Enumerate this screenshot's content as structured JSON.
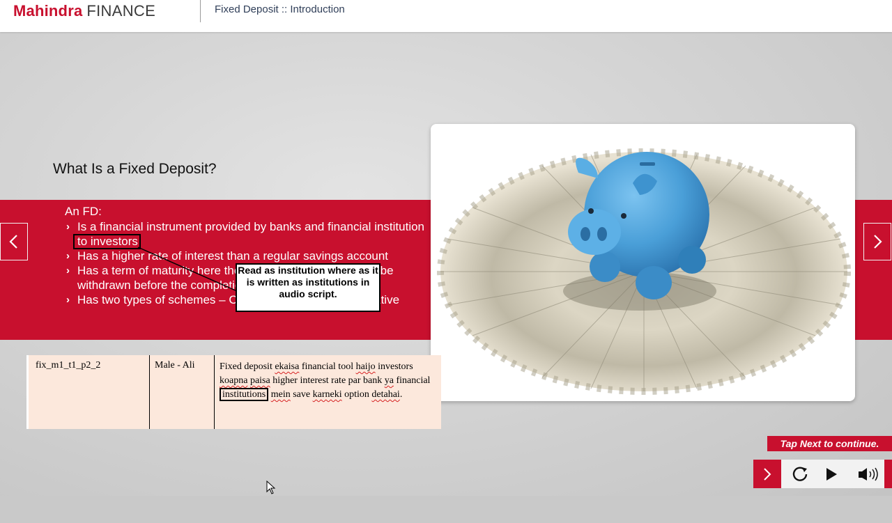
{
  "header": {
    "brand": "Mahindra",
    "brand_sub": "FINANCE",
    "breadcrumb": "Fixed Deposit :: Introduction"
  },
  "slide": {
    "title": "What Is a Fixed Deposit?",
    "intro": "An FD:",
    "bullets": [
      {
        "before": "Is a financial instrument provided by banks and financial ",
        "highlight": "institution",
        "after": " to investors"
      },
      {
        "text": "Has a higher rate of interest than a regular savings account"
      },
      {
        "text": "Has a term of maturity here the deposited amount cannot be withdrawn before the completion"
      },
      {
        "text": "Has two types of schemes – Cumulative and Non-Cumulative"
      }
    ],
    "callout": "Read as institution where as it is written as institutions in audio script."
  },
  "script_table": {
    "id": "fix_m1_t1_p2_2",
    "voice": "Male - Ali",
    "text_parts": {
      "p1": "Fixed deposit ",
      "w1": "ekaisa",
      "p2": " financial tool ",
      "w2": "haijo",
      "p3": " investors ",
      "w3": "koapna",
      "p4": " ",
      "w4": "paisa",
      "p5": " higher interest rate par bank ",
      "w5": "ya",
      "p6": " financial ",
      "boxed": "institutions",
      "p7": " ",
      "w6": "mein",
      "p8": " save ",
      "w7": "karneki",
      "p9": " option ",
      "w8": "detahai",
      "p10": "."
    }
  },
  "controls": {
    "tap_next": "Tap Next to continue.",
    "icons": [
      "chevron-right-icon",
      "replay-icon",
      "play-icon",
      "speaker-icon"
    ]
  },
  "colors": {
    "brand_red": "#c8102e",
    "header_text": "#2f3e58",
    "table_bg": "#fce8dc",
    "piggy_blue": "#4a9fd8"
  }
}
